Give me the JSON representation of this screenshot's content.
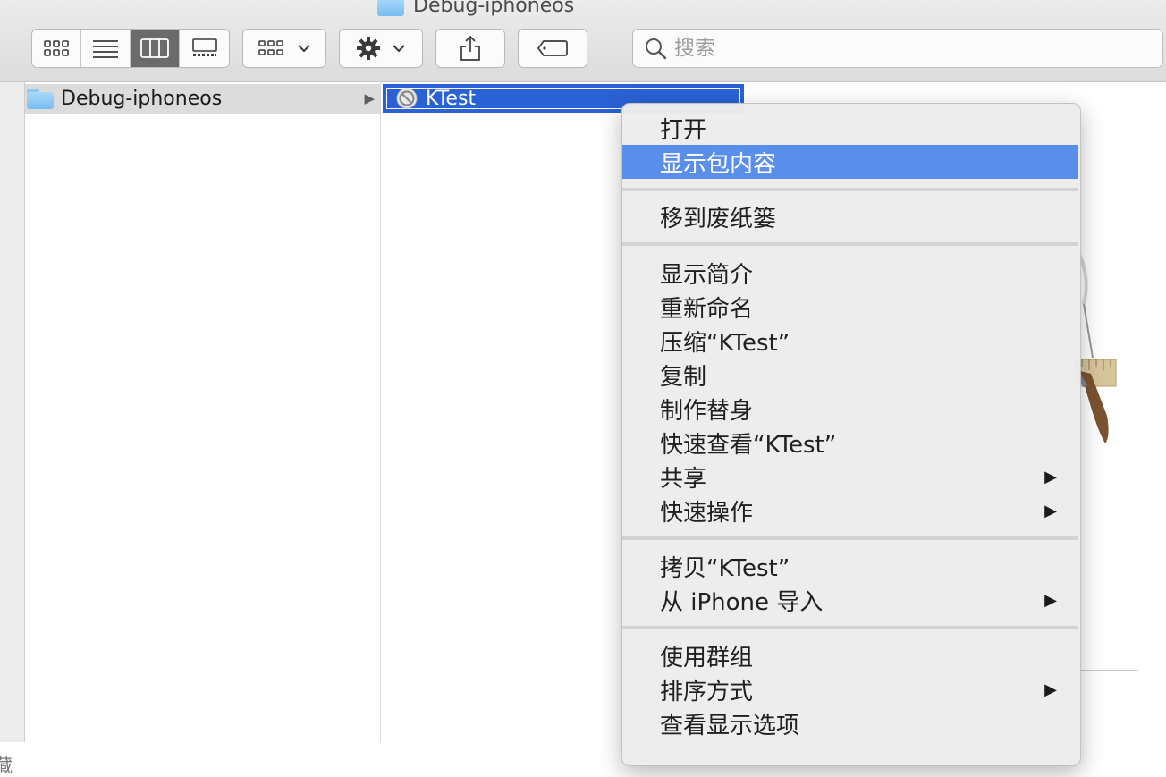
{
  "window": {
    "title": "Debug-iphoneos"
  },
  "toolbar": {
    "view_modes": [
      "icon-view",
      "list-view",
      "column-view",
      "gallery-view"
    ],
    "active_view": "column-view",
    "search_placeholder": "搜索"
  },
  "sidebar": {
    "partial_label": "藏"
  },
  "columns": {
    "first": {
      "folder_label": "Debug-iphoneos"
    },
    "second": {
      "selected_item_label": "KTest"
    }
  },
  "context_menu": {
    "items": [
      {
        "label": "打开"
      },
      {
        "label": "显示包内容",
        "highlighted": true
      },
      {
        "label": "移到废纸篓"
      },
      {
        "label": "显示简介"
      },
      {
        "label": "重新命名"
      },
      {
        "label": "压缩“KTest”"
      },
      {
        "label": "复制"
      },
      {
        "label": "制作替身"
      },
      {
        "label": "快速查看“KTest”"
      },
      {
        "label": "共享",
        "submenu": true
      },
      {
        "label": "快速操作",
        "submenu": true
      },
      {
        "label": "拷贝“KTest”"
      },
      {
        "label": "从 iPhone 导入",
        "submenu": true
      },
      {
        "label": "使用群组"
      },
      {
        "label": "排序方式",
        "submenu": true
      },
      {
        "label": "查看显示选项"
      }
    ],
    "submenu_arrow": "▶"
  },
  "colors": {
    "selection": "#2a62d6",
    "menu_highlight": "#5a8eeb",
    "folder_blue": "#77bdef"
  }
}
